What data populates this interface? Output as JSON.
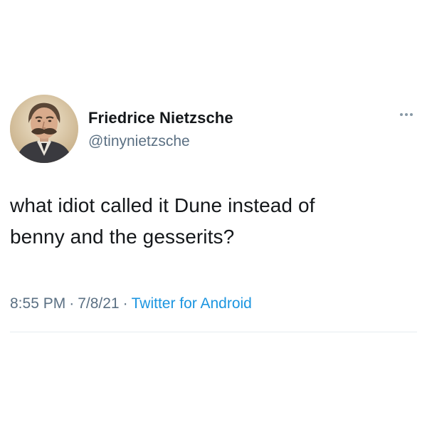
{
  "author": {
    "display_name": "Friedrice Nietzsche",
    "handle": "@tinynietzsche",
    "avatar_icon": "portrait-avatar"
  },
  "tweet": {
    "text": "what idiot called it Dune instead of\nbenny and the gesserits?",
    "time": "8:55 PM",
    "separator": "·",
    "date": "7/8/21",
    "source": "Twitter for Android"
  },
  "actions": {
    "more_icon": "more-options-icon"
  },
  "colors": {
    "text": "#14171a",
    "secondary": "#5b7083",
    "link": "#1b95e0",
    "divider": "#e6ecf0",
    "background": "#ffffff"
  }
}
